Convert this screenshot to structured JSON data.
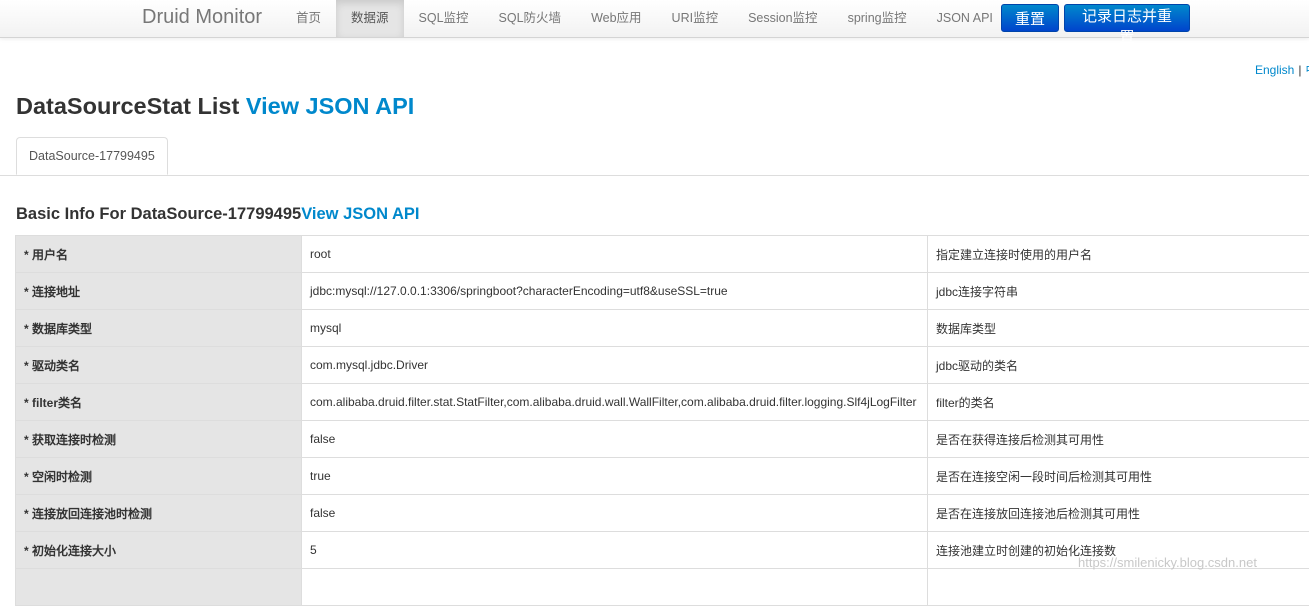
{
  "navbar": {
    "brand": "Druid Monitor",
    "items": [
      "首页",
      "数据源",
      "SQL监控",
      "SQL防火墙",
      "Web应用",
      "URI监控",
      "Session监控",
      "spring监控",
      "JSON API"
    ],
    "reset_label": "重置",
    "reset_log_label": "记录日志并重置"
  },
  "lang": {
    "english": "English",
    "sep": "|",
    "chinese": "中文"
  },
  "page": {
    "title": "DataSourceStat List ",
    "title_link": "View JSON API"
  },
  "tabs": [
    "DataSource-17799495"
  ],
  "section": {
    "title": "Basic Info For DataSource-17799495",
    "title_link": "View JSON API"
  },
  "rows": [
    {
      "label": "* 用户名",
      "value": "root",
      "desc": "指定建立连接时使用的用户名"
    },
    {
      "label": "* 连接地址",
      "value": "jdbc:mysql://127.0.0.1:3306/springboot?characterEncoding=utf8&useSSL=true",
      "desc": "jdbc连接字符串"
    },
    {
      "label": "* 数据库类型",
      "value": "mysql",
      "desc": "数据库类型"
    },
    {
      "label": "* 驱动类名",
      "value": "com.mysql.jdbc.Driver",
      "desc": "jdbc驱动的类名"
    },
    {
      "label": "* filter类名",
      "value": "com.alibaba.druid.filter.stat.StatFilter,com.alibaba.druid.wall.WallFilter,com.alibaba.druid.filter.logging.Slf4jLogFilter",
      "desc": "filter的类名"
    },
    {
      "label": "* 获取连接时检测",
      "value": "false",
      "desc": "是否在获得连接后检测其可用性"
    },
    {
      "label": "* 空闲时检测",
      "value": "true",
      "desc": "是否在连接空闲一段时间后检测其可用性"
    },
    {
      "label": "* 连接放回连接池时检测",
      "value": "false",
      "desc": "是否在连接放回连接池后检测其可用性"
    },
    {
      "label": "* 初始化连接大小",
      "value": "5",
      "desc": "连接池建立时创建的初始化连接数"
    },
    {
      "label": "",
      "value": "",
      "desc": ""
    }
  ],
  "watermark": "https://smilenicky.blog.csdn.net"
}
